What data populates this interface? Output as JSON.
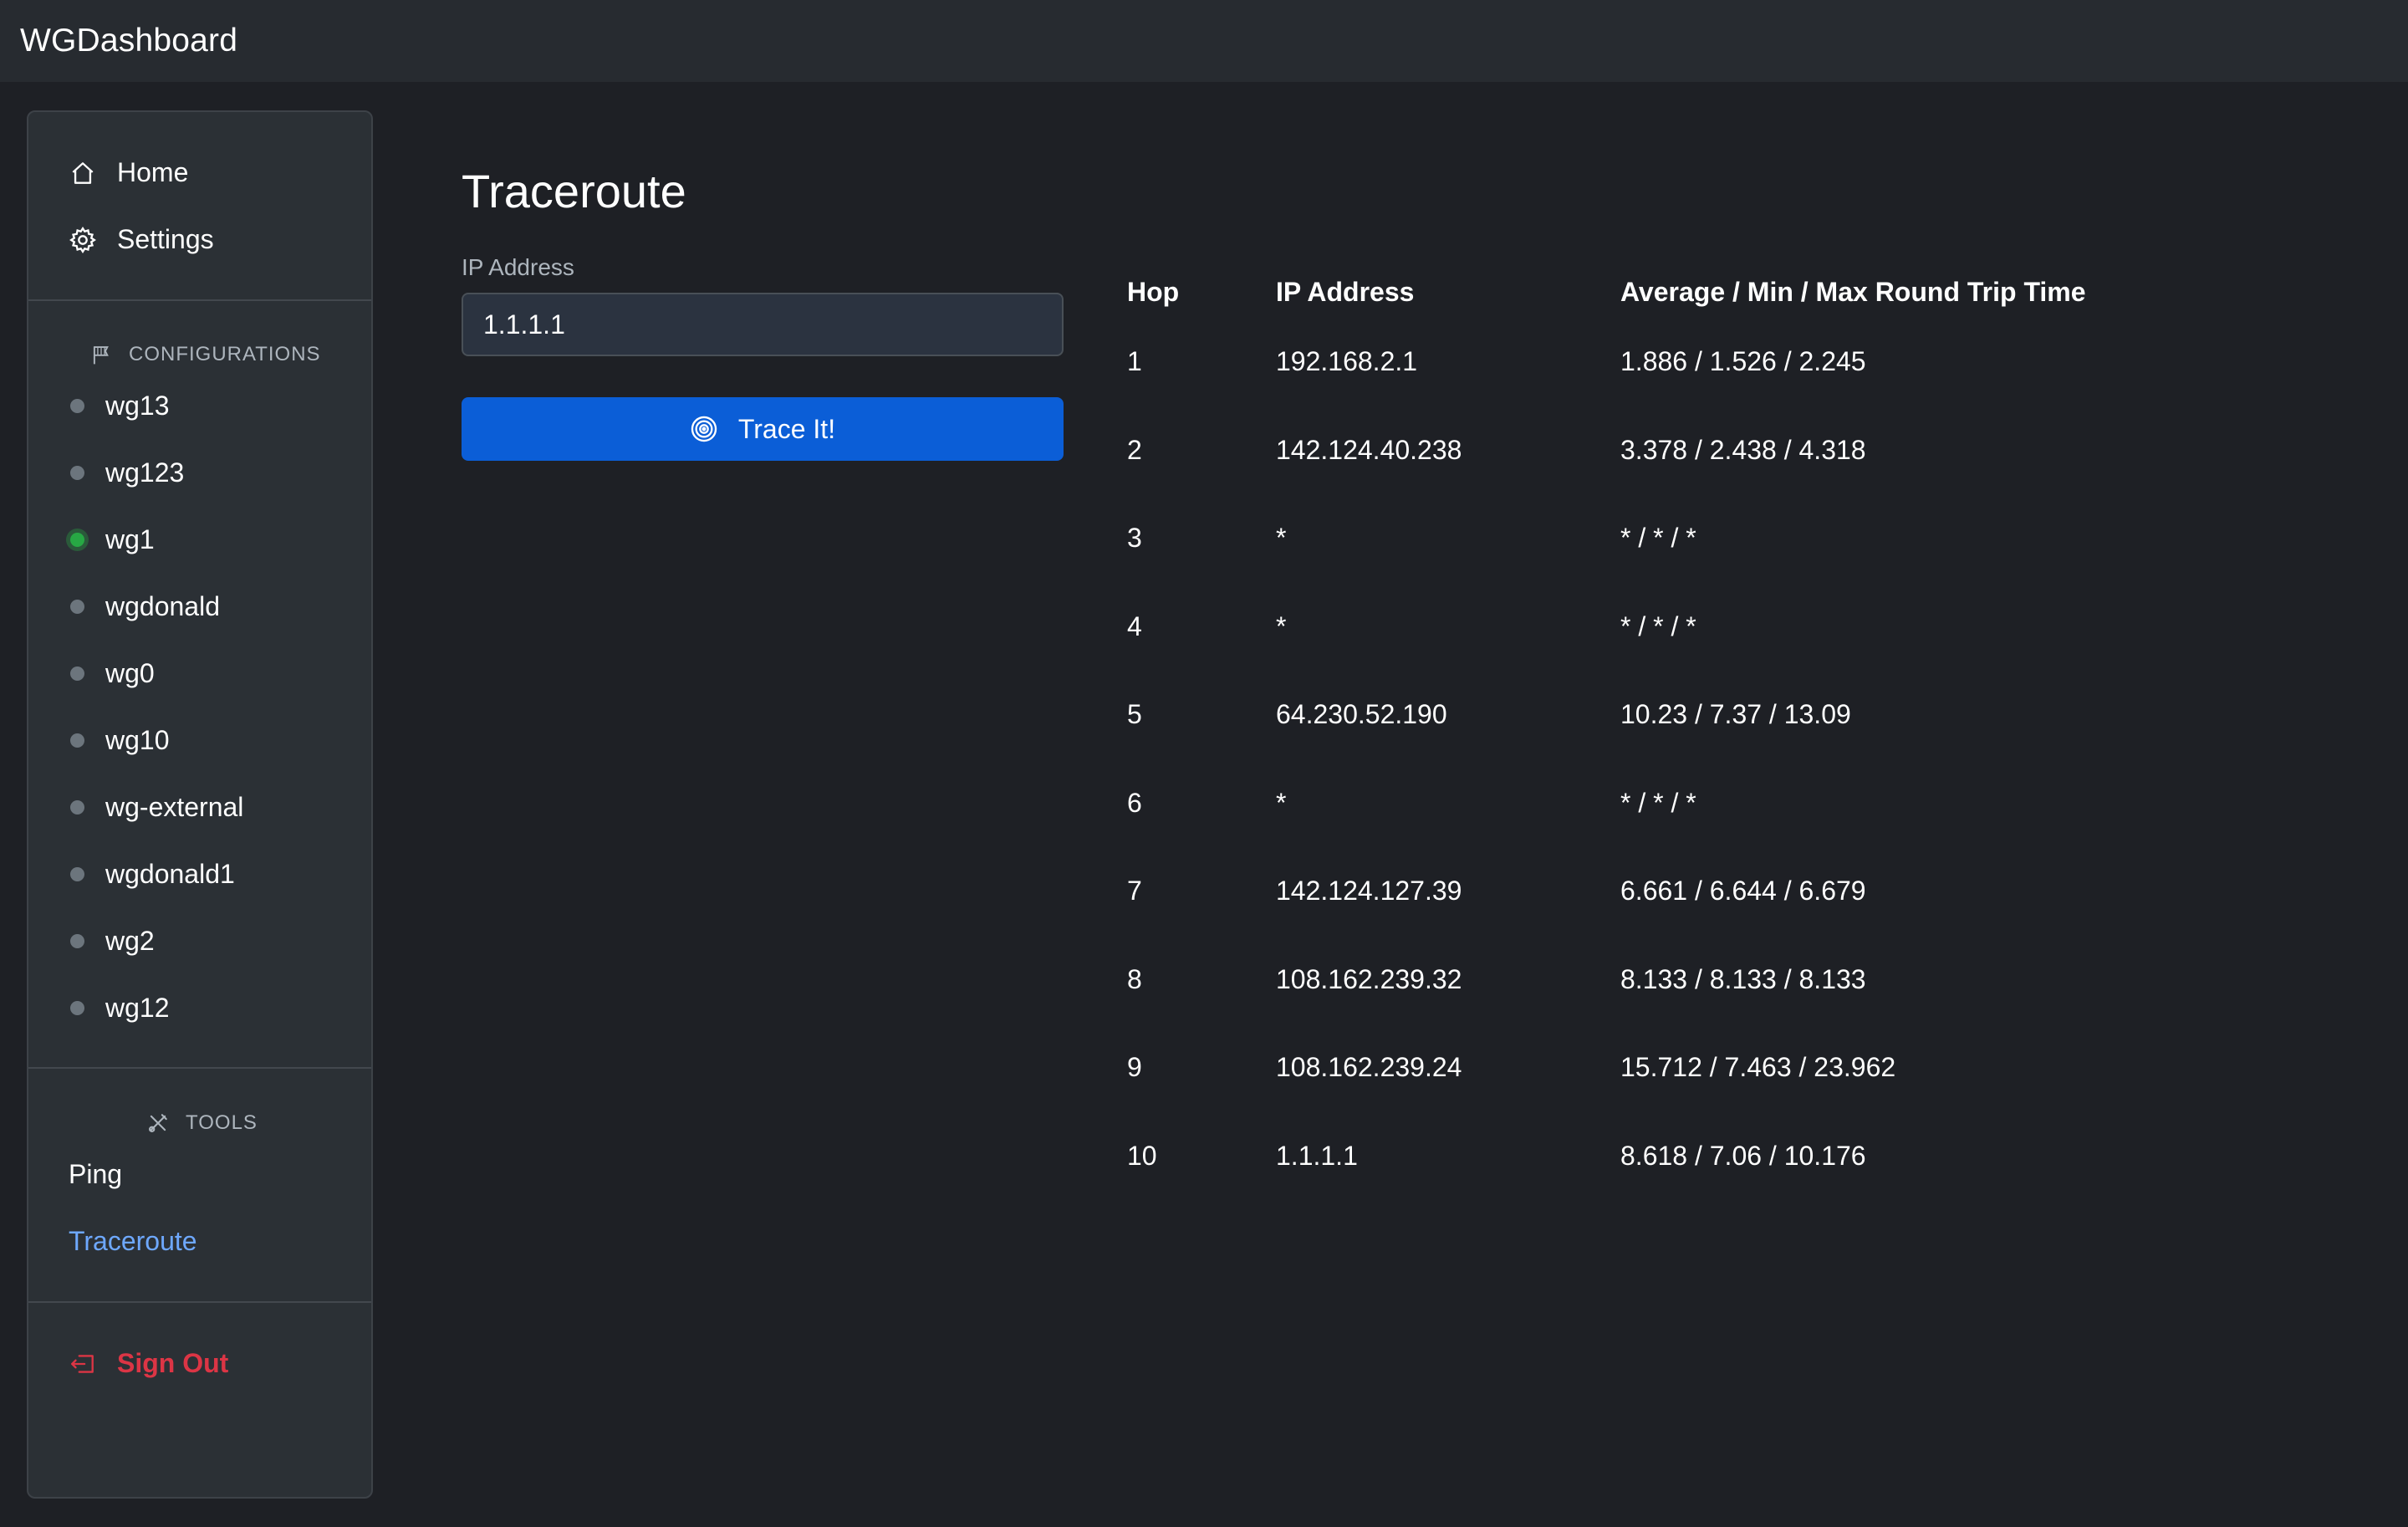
{
  "app": {
    "brand": "WGDashboard"
  },
  "sidebar": {
    "nav": [
      {
        "label": "Home",
        "icon": "house-icon"
      },
      {
        "label": "Settings",
        "icon": "gear-icon"
      }
    ],
    "configurations_heading": "CONFIGURATIONS",
    "configurations": [
      {
        "name": "wg13",
        "active": false
      },
      {
        "name": "wg123",
        "active": false
      },
      {
        "name": "wg1",
        "active": true
      },
      {
        "name": "wgdonald",
        "active": false
      },
      {
        "name": "wg0",
        "active": false
      },
      {
        "name": "wg10",
        "active": false
      },
      {
        "name": "wg-external",
        "active": false
      },
      {
        "name": "wgdonald1",
        "active": false
      },
      {
        "name": "wg2",
        "active": false
      },
      {
        "name": "wg12",
        "active": false
      }
    ],
    "tools_heading": "TOOLS",
    "tools": [
      {
        "label": "Ping",
        "current": false
      },
      {
        "label": "Traceroute",
        "current": true
      }
    ],
    "signout_label": "Sign Out"
  },
  "main": {
    "title": "Traceroute",
    "ip_label": "IP Address",
    "ip_value": "1.1.1.1",
    "button_label": "Trace It!"
  },
  "results": {
    "headers": [
      "Hop",
      "IP Address",
      "Average / Min / Max Round Trip Time"
    ],
    "rows": [
      [
        "1",
        "192.168.2.1",
        "1.886 / 1.526 / 2.245"
      ],
      [
        "2",
        "142.124.40.238",
        "3.378 / 2.438 / 4.318"
      ],
      [
        "3",
        "*",
        "* / * / *"
      ],
      [
        "4",
        "*",
        "* / * / *"
      ],
      [
        "5",
        "64.230.52.190",
        "10.23 / 7.37 / 13.09"
      ],
      [
        "6",
        "*",
        "* / * / *"
      ],
      [
        "7",
        "142.124.127.39",
        "6.661 / 6.644 / 6.679"
      ],
      [
        "8",
        "108.162.239.32",
        "8.133 / 8.133 / 8.133"
      ],
      [
        "9",
        "108.162.239.24",
        "15.712 / 7.463 / 23.962"
      ],
      [
        "10",
        "1.1.1.1",
        "8.618 / 7.06 / 10.176"
      ]
    ]
  },
  "colors": {
    "accent": "#0b5ed7",
    "link_active": "#6ea8fe",
    "status_active": "#27a844",
    "status_inactive": "#6c757d",
    "danger": "#dc3545"
  }
}
